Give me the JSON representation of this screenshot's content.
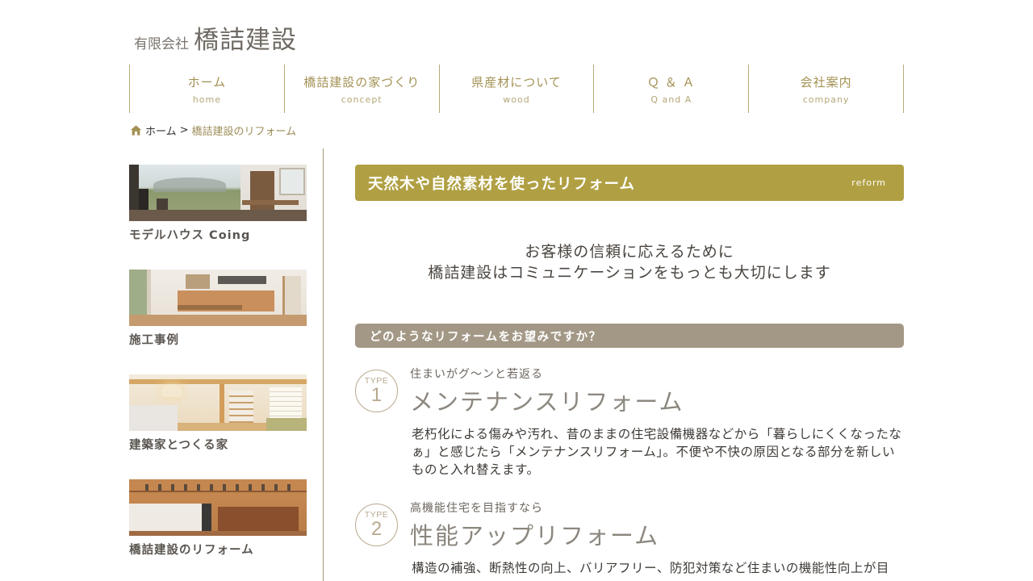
{
  "header": {
    "logo_prefix": "有限会社",
    "logo_name": "橋詰建設"
  },
  "nav": [
    {
      "jp": "ホーム",
      "en": "home"
    },
    {
      "jp": "橋詰建設の家づくり",
      "en": "concept"
    },
    {
      "jp": "県産材について",
      "en": "wood"
    },
    {
      "jp": "Ｑ ＆ Ａ",
      "en": "Q and A"
    },
    {
      "jp": "会社案内",
      "en": "company"
    }
  ],
  "breadcrumb": {
    "home": "ホーム",
    "separator": ">",
    "current": "橋詰建設のリフォーム"
  },
  "sidebar": {
    "items": [
      {
        "label": "モデルハウス Coing"
      },
      {
        "label": "施工事例"
      },
      {
        "label": "建築家とつくる家"
      },
      {
        "label": "橋詰建設のリフォーム"
      }
    ]
  },
  "main": {
    "title": "天然木や自然素材を使ったリフォーム",
    "title_en": "reform",
    "lead_line1": "お客様の信頼に応えるために",
    "lead_line2": "橋詰建設はコミュニケーションをもっとも大切にします",
    "question": "どのようなリフォームをお望みですか？",
    "types": [
      {
        "badge_label": "TYPE",
        "badge_number": "1",
        "kicker": "住まいがグ～ンと若返る",
        "heading": "メンテナンスリフォーム",
        "description": "老朽化による傷みや汚れ、昔のままの住宅設備機器などから「暮らしにくくなったなぁ」と感じたら「メンテナンスリフォーム」。不便や不快の原因となる部分を新しいものと入れ替えます。"
      },
      {
        "badge_label": "TYPE",
        "badge_number": "2",
        "kicker": "高機能住宅を目指すなら",
        "heading": "性能アップリフォーム",
        "description": "構造の補強、断熱性の向上、バリアフリー、防犯対策など住まいの機能性向上が目"
      }
    ]
  },
  "colors": {
    "accent_gold": "#b0a043",
    "sub_bar": "#a39886",
    "nav_text": "#a39153",
    "divider": "#a7967a"
  }
}
